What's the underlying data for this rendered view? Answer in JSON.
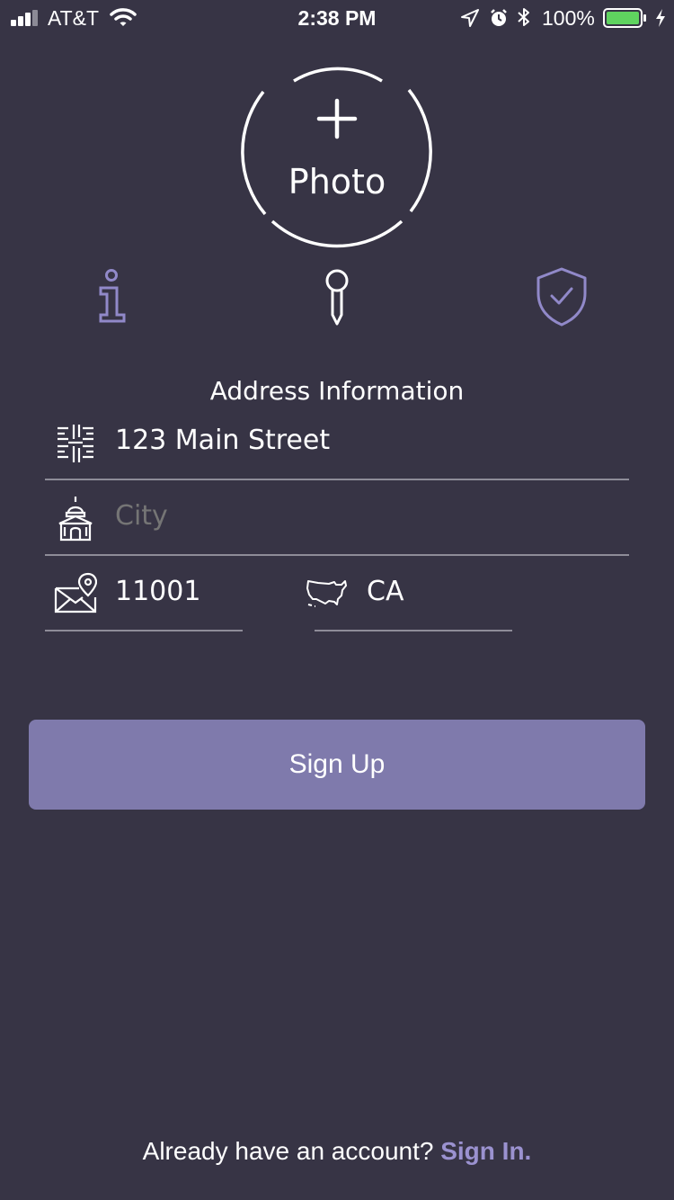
{
  "status_bar": {
    "carrier": "AT&T",
    "time": "2:38 PM",
    "battery_percent": "100%",
    "battery_level": 1.0,
    "icons": [
      "signal-icon",
      "wifi-icon",
      "location-arrow-icon",
      "alarm-icon",
      "bluetooth-icon",
      "battery-icon",
      "charging-bolt-icon"
    ]
  },
  "photo": {
    "plus_symbol": "+",
    "label": "Photo"
  },
  "steps": [
    {
      "icon": "info-icon",
      "active": false
    },
    {
      "icon": "pin-icon",
      "active": true
    },
    {
      "icon": "shield-check-icon",
      "active": false
    }
  ],
  "section_title": "Address Information",
  "fields": {
    "street": {
      "value": "123 Main Street",
      "icon": "street-map-icon"
    },
    "city": {
      "placeholder": "City",
      "icon": "city-hall-icon"
    },
    "zip": {
      "value": "11001",
      "icon": "envelope-pin-icon"
    },
    "state": {
      "value": "CA",
      "icon": "us-map-icon"
    }
  },
  "signup_button": "Sign Up",
  "footer": {
    "prompt": "Already have an account?",
    "link": "Sign In."
  },
  "colors": {
    "background": "#373445",
    "accent": "#7f7aac",
    "link": "#9b92d0",
    "icon_inactive": "#9189c9",
    "battery_fill": "#5fd35f"
  }
}
